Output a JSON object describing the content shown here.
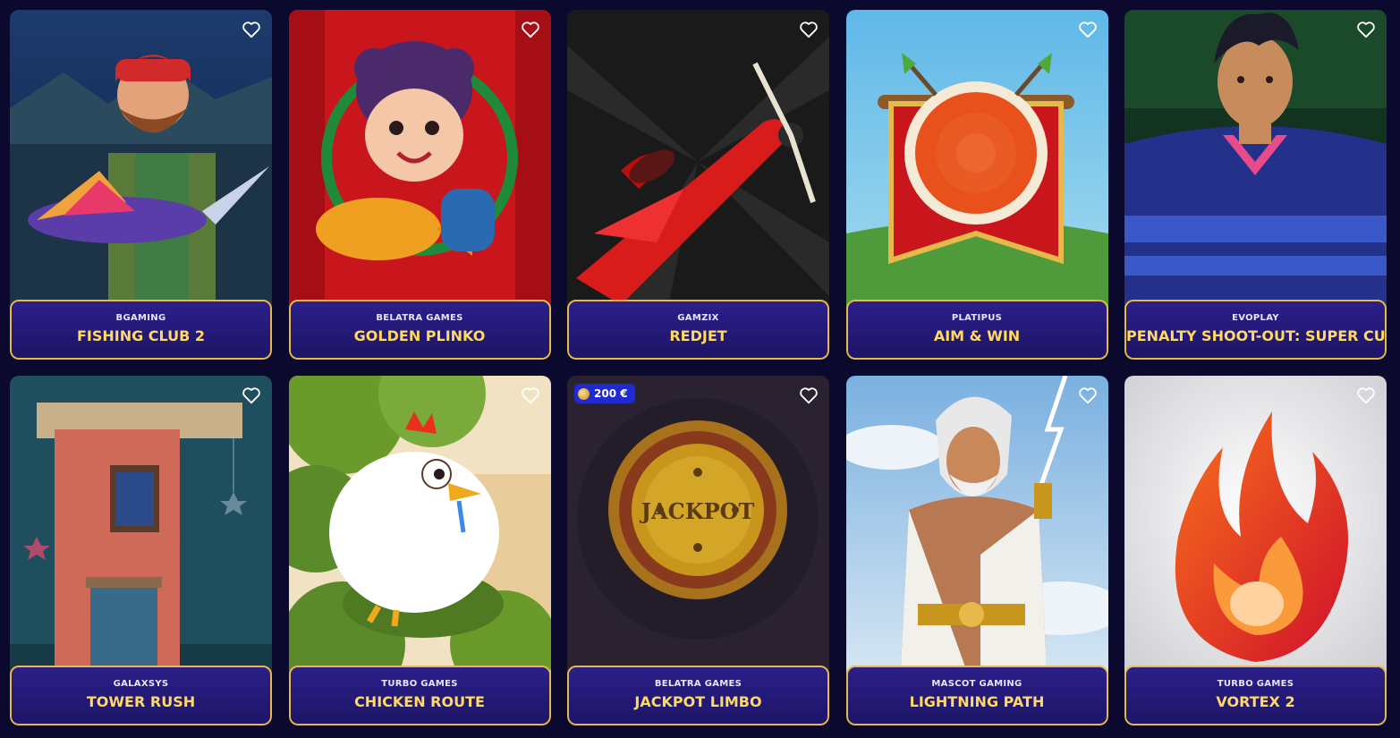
{
  "games": [
    {
      "provider": "BGAMING",
      "title": "FISHING CLUB 2",
      "favorite_icon": "heart-outline-icon"
    },
    {
      "provider": "BELATRA GAMES",
      "title": "GOLDEN PLINKO",
      "favorite_icon": "heart-outline-icon"
    },
    {
      "provider": "GAMZIX",
      "title": "REDJET",
      "favorite_icon": "heart-outline-icon"
    },
    {
      "provider": "PLATIPUS",
      "title": "AIM & WIN",
      "favorite_icon": "heart-outline-icon"
    },
    {
      "provider": "EVOPLAY",
      "title": "PENALTY SHOOT-OUT: SUPER CUP",
      "favorite_icon": "heart-outline-icon"
    },
    {
      "provider": "GALAXSYS",
      "title": "TOWER RUSH",
      "favorite_icon": "heart-outline-icon"
    },
    {
      "provider": "TURBO GAMES",
      "title": "CHICKEN ROUTE",
      "favorite_icon": "heart-outline-icon"
    },
    {
      "provider": "BELATRA GAMES",
      "title": "JACKPOT LIMBO",
      "favorite_icon": "heart-outline-icon",
      "badge": "200 €"
    },
    {
      "provider": "MASCOT GAMING",
      "title": "LIGHTNING PATH",
      "favorite_icon": "heart-outline-icon"
    },
    {
      "provider": "TURBO GAMES",
      "title": "VORTEX 2",
      "favorite_icon": "heart-outline-icon"
    }
  ],
  "artwork": {
    "jackpot_coin_text": "JACKPOT"
  },
  "colors": {
    "page_background": "#0b0a2e",
    "card_info_background": "#231a78",
    "card_border": "#e6b94a",
    "title_text": "#ffd964",
    "provider_text": "#e9e4ff",
    "badge_background": "#1f2ad0"
  }
}
